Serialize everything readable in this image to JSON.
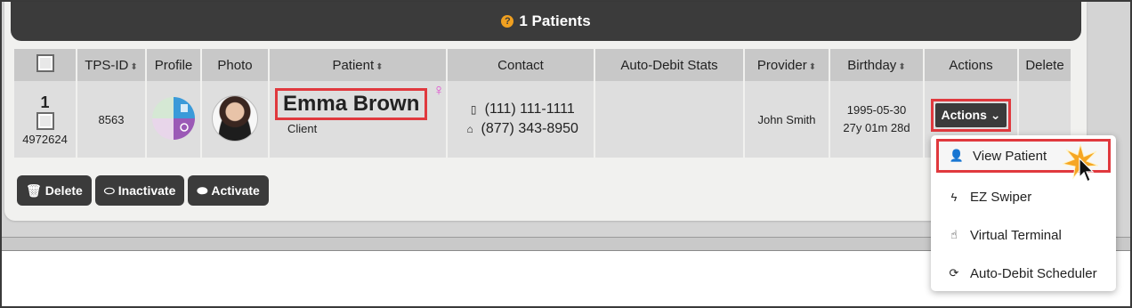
{
  "header": {
    "title": "1 Patients",
    "help_icon": "?"
  },
  "columns": {
    "tps_id": "TPS-ID",
    "profile": "Profile",
    "photo": "Photo",
    "patient": "Patient",
    "contact": "Contact",
    "auto_debit": "Auto-Debit Stats",
    "provider": "Provider",
    "birthday": "Birthday",
    "actions": "Actions",
    "delete": "Delete"
  },
  "row": {
    "num": "1",
    "account_id": "4972624",
    "tps_id": "8563",
    "name": "Emma Brown",
    "gender_symbol": "♀",
    "type": "Client",
    "phone_mobile": "(111) 111-1111",
    "phone_home": "(877) 343-8950",
    "auto_debit": "",
    "provider": "John Smith",
    "birth_date": "1995-05-30",
    "age": "27y 01m 28d",
    "actions_label": "Actions"
  },
  "buttons": {
    "delete": "Delete",
    "inactivate": "Inactivate",
    "activate": "Activate"
  },
  "dropdown": {
    "items": [
      {
        "label": "View Patient",
        "icon": "user-icon"
      },
      {
        "label": "EZ Swiper",
        "icon": "bolt-icon"
      },
      {
        "label": "Virtual Terminal",
        "icon": "hand-pointer-icon"
      },
      {
        "label": "Auto-Debit Scheduler",
        "icon": "refresh-icon"
      }
    ]
  },
  "colors": {
    "header_bg": "#3b3b3b",
    "highlight": "#e0393e",
    "help_orange": "#f0a020",
    "female_pink": "#e050d0"
  }
}
